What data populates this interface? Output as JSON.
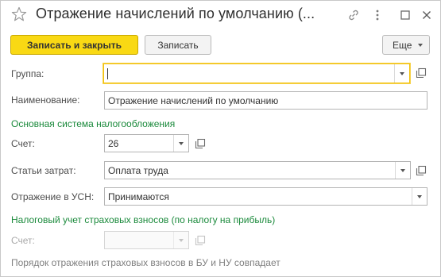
{
  "window": {
    "title": "Отражение начислений по умолчанию (..."
  },
  "toolbar": {
    "save_close_label": "Записать и закрыть",
    "save_label": "Записать",
    "more_label": "Еще"
  },
  "form": {
    "group": {
      "label": "Группа:",
      "value": ""
    },
    "name": {
      "label": "Наименование:",
      "value": "Отражение начислений по умолчанию"
    },
    "main_tax_section": "Основная система налогообложения",
    "account": {
      "label": "Счет:",
      "value": "26"
    },
    "cost_items": {
      "label": "Статьи затрат:",
      "value": "Оплата труда"
    },
    "usn": {
      "label": "Отражение в УСН:",
      "value": "Принимаются"
    },
    "insurance_section": "Налоговый учет страховых взносов (по налогу на прибыль)",
    "insurance_account": {
      "label": "Счет:",
      "value": ""
    },
    "note": "Порядок отражения страховых взносов в БУ и НУ совпадает"
  },
  "colors": {
    "primary_button": "#f9d914",
    "section_heading": "#1b8a3c",
    "focus_border": "#f2c10a"
  },
  "icons": {
    "favorite": "star-icon",
    "link": "link-icon",
    "more": "kebab-icon",
    "maximize": "maximize-icon",
    "close": "close-icon",
    "open": "open-icon"
  }
}
